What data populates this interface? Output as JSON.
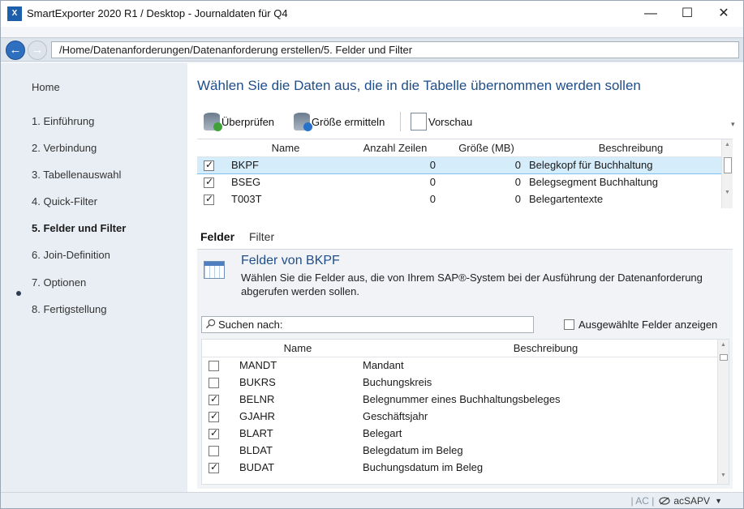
{
  "window": {
    "title": "SmartExporter 2020 R1 / Desktop - Journaldaten für Q4",
    "app_icon_text": "X",
    "minimize_glyph": "—",
    "maximize_glyph": "☐",
    "close_glyph": "✕"
  },
  "addressbar": {
    "path": "/Home/Datenanforderungen/Datenanforderung erstellen/5. Felder und Filter"
  },
  "sidebar": {
    "items": [
      {
        "label": "Home"
      },
      {
        "label": "1. Einführung"
      },
      {
        "label": "2. Verbindung"
      },
      {
        "label": "3. Tabellenauswahl"
      },
      {
        "label": "4. Quick-Filter"
      },
      {
        "label": "5. Felder und Filter",
        "active": true
      },
      {
        "label": "6. Join-Definition"
      },
      {
        "label": "7. Optionen"
      },
      {
        "label": "8. Fertigstellung"
      }
    ]
  },
  "main": {
    "heading": "Wählen Sie die Daten aus, die in die Tabelle übernommen werden sollen",
    "toolbar": {
      "check_label": "Überprüfen",
      "size_label": "Größe ermitteln",
      "preview_label": "Vorschau"
    },
    "tables_grid": {
      "columns": [
        "Name",
        "Anzahl Zeilen",
        "Größe (MB)",
        "Beschreibung"
      ],
      "rows": [
        {
          "checked": true,
          "name": "BKPF",
          "rows": "0",
          "size": "0",
          "desc": "Belegkopf für Buchhaltung",
          "selected": true
        },
        {
          "checked": true,
          "name": "BSEG",
          "rows": "0",
          "size": "0",
          "desc": "Belegsegment Buchhaltung"
        },
        {
          "checked": true,
          "name": "T003T",
          "rows": "0",
          "size": "0",
          "desc": "Belegartentexte"
        }
      ]
    },
    "tabs": [
      "Felder",
      "Filter"
    ],
    "fields_panel": {
      "title": "Felder von BKPF",
      "description": "Wählen Sie die Felder aus, die von Ihrem SAP®-System bei der Ausführung der Datenanforderung abgerufen werden sollen.",
      "search_placeholder": "Suchen nach:",
      "selected_only_label": "Ausgewählte Felder anzeigen",
      "columns": [
        "Name",
        "Beschreibung"
      ],
      "rows": [
        {
          "checked": false,
          "name": "MANDT",
          "desc": "Mandant"
        },
        {
          "checked": false,
          "name": "BUKRS",
          "desc": "Buchungskreis"
        },
        {
          "checked": true,
          "name": "BELNR",
          "desc": "Belegnummer eines Buchhaltungsbeleges"
        },
        {
          "checked": true,
          "name": "GJAHR",
          "desc": "Geschäftsjahr"
        },
        {
          "checked": true,
          "name": "BLART",
          "desc": "Belegart"
        },
        {
          "checked": false,
          "name": "BLDAT",
          "desc": "Belegdatum im Beleg"
        },
        {
          "checked": true,
          "name": "BUDAT",
          "desc": "Buchungsdatum im Beleg"
        }
      ]
    }
  },
  "statusbar": {
    "system_sep": "| AC |",
    "system_name": "acSAPV",
    "dropdown_glyph": "▼"
  },
  "colors": {
    "heading_blue": "#1f4e89",
    "selection_bg": "#d5ecfa",
    "sidebar_bg": "#e9eef4"
  }
}
